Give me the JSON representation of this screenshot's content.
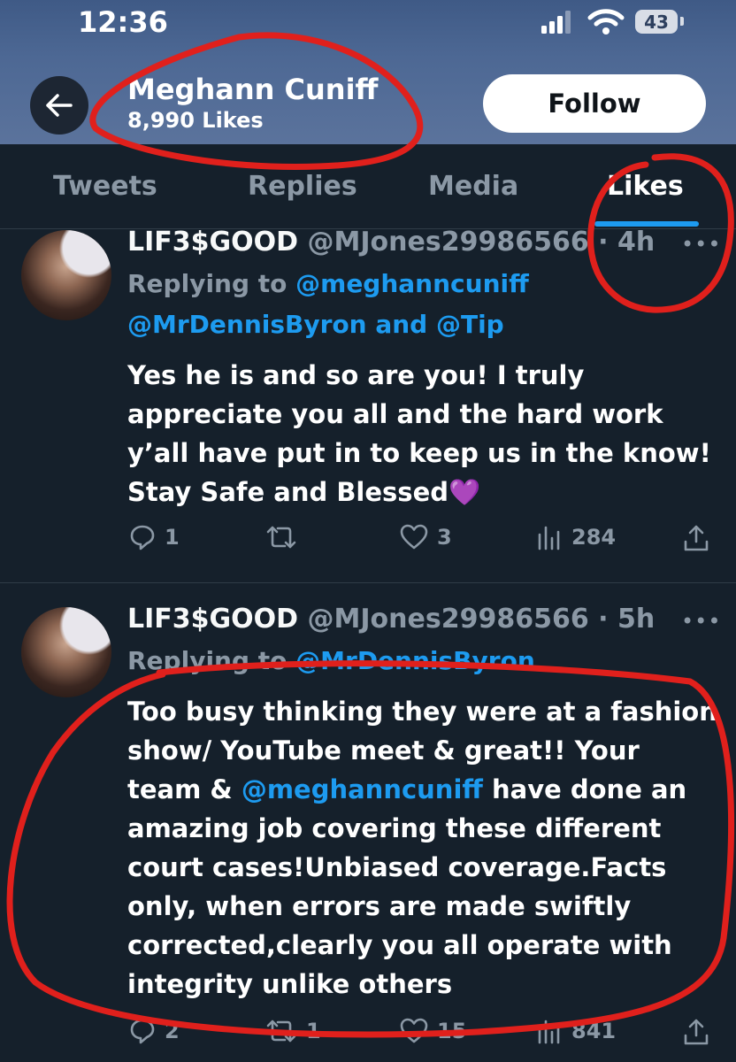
{
  "status": {
    "time": "12:36",
    "battery": "43"
  },
  "profile": {
    "name": "Meghann Cuniff",
    "likes": "8,990 Likes",
    "follow_label": "Follow"
  },
  "tabs": [
    {
      "label": "Tweets"
    },
    {
      "label": "Replies"
    },
    {
      "label": "Media"
    },
    {
      "label": "Likes",
      "active": true
    }
  ],
  "tweets": [
    {
      "display_name": "LIF3$GOOD",
      "handle": "@MJones29986566",
      "time": "4h",
      "replying_prefix": "Replying to",
      "replying_line1": "@meghanncuniff",
      "replying_line2": "@MrDennisByron and @Tip",
      "text": "Yes he is and so are you! I truly appreciate you all and the hard work y’all have put in to keep us in the know! Stay Safe and Blessed💜",
      "replies": "1",
      "retweets": "",
      "likes": "3",
      "views": "284"
    },
    {
      "display_name": "LIF3$GOOD",
      "handle": "@MJones29986566",
      "time": "5h",
      "replying_prefix": "Replying to",
      "replying_line1": "@MrDennisByron",
      "text_before": "Too busy thinking they were at a fashion show/ YouTube meet & great!! Your team & ",
      "text_mention": "@meghanncuniff",
      "text_after": " have done an amazing job covering these different court cases!Unbiased coverage.Facts only, when errors are made swiftly corrected,clearly you all operate with integrity unlike others",
      "replies": "2",
      "retweets": "1",
      "likes": "15",
      "views": "841"
    }
  ],
  "colors": {
    "background": "#15202b",
    "accent": "#1d9bf0",
    "muted": "#8b98a5",
    "annotation": "#e0201c"
  }
}
